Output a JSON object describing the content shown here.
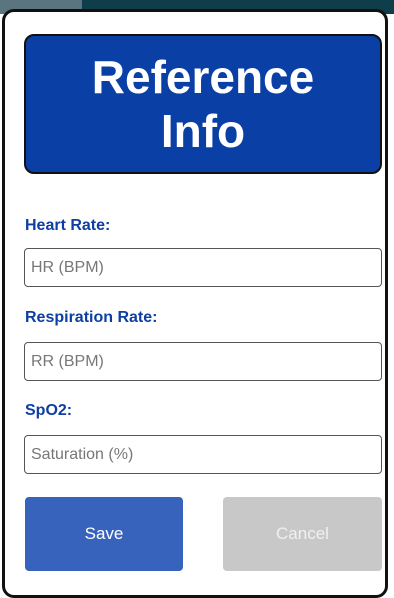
{
  "dialog": {
    "title": "Reference Info",
    "fields": [
      {
        "label": "Heart Rate:",
        "placeholder": "HR (BPM)",
        "value": ""
      },
      {
        "label": "Respiration Rate:",
        "placeholder": "RR (BPM)",
        "value": ""
      },
      {
        "label": "SpO2:",
        "placeholder": "Saturation (%)",
        "value": ""
      }
    ],
    "buttons": {
      "save_label": "Save",
      "cancel_label": "Cancel"
    }
  },
  "colors": {
    "header_background": "#0a3fa6",
    "label_text": "#0d3fa3",
    "save_button": "#3763bc",
    "cancel_button_disabled": "#c8c8c8"
  }
}
